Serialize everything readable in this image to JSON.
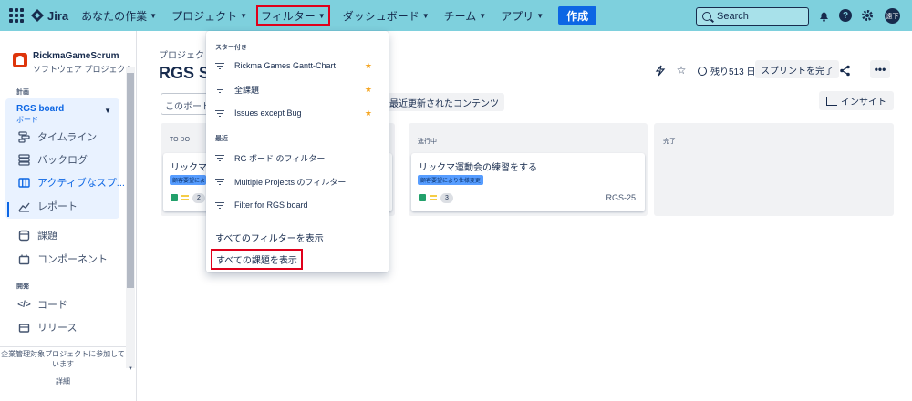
{
  "topnav": {
    "logo": "Jira",
    "items": [
      {
        "label": "あなたの作業"
      },
      {
        "label": "プロジェクト"
      },
      {
        "label": "フィルター"
      },
      {
        "label": "ダッシュボード"
      },
      {
        "label": "チーム"
      },
      {
        "label": "アプリ"
      }
    ],
    "create_label": "作成",
    "search_placeholder": "Search",
    "avatar_initials": "遠下"
  },
  "sidebar": {
    "project_name": "RickmaGameScrum",
    "project_type": "ソフトウェア プロジェクト",
    "section_plan": "計画",
    "board_name": "RGS board",
    "board_sub": "ボード",
    "board_items": [
      {
        "label": "タイムライン"
      },
      {
        "label": "バックログ"
      },
      {
        "label": "アクティブなスプ..."
      },
      {
        "label": "レポート"
      }
    ],
    "items": [
      {
        "label": "課題"
      },
      {
        "label": "コンポーネント"
      }
    ],
    "section_dev": "開発",
    "dev_items": [
      {
        "label": "コード"
      },
      {
        "label": "リリース"
      }
    ],
    "footer_text": "企業管理対象プロジェクトに参加しています",
    "footer_more": "詳細"
  },
  "main": {
    "breadcrumb": "プロジェクト",
    "title": "RGS Spr",
    "remaining": "残り513 日",
    "complete_sprint": "スプリントを完了",
    "search_placeholder": "このボード",
    "recent_updated": "最近更新されたコンテンツ",
    "insight": "インサイト",
    "columns": [
      {
        "title": "TO DO"
      },
      {
        "title": "進行中"
      },
      {
        "title": "完了"
      }
    ],
    "cards": [
      {
        "title": "リックマヒ",
        "label": "顧客要望によ",
        "points": "2",
        "key": ""
      },
      {
        "title": "リックマ運動会の練習をする",
        "label": "顧客要望により仕様変更",
        "points": "3",
        "key": "RGS-25"
      }
    ]
  },
  "dropdown": {
    "section_starred": "スター付き",
    "starred": [
      {
        "label": "Rickma Games Gantt-Chart"
      },
      {
        "label": "全課題"
      },
      {
        "label": "Issues except Bug"
      }
    ],
    "section_recent": "最近",
    "recent": [
      {
        "label": "RG ボード のフィルター"
      },
      {
        "label": "Multiple Projects のフィルター"
      },
      {
        "label": "Filter for RGS board"
      }
    ],
    "view_all_filters": "すべてのフィルターを表示",
    "view_all_issues": "すべての課題を表示"
  },
  "colors": {
    "topnav_bg": "#7ed0dd",
    "accent": "#0c66e4",
    "highlight_border": "#e0001b",
    "label_bg": "#579dff"
  }
}
